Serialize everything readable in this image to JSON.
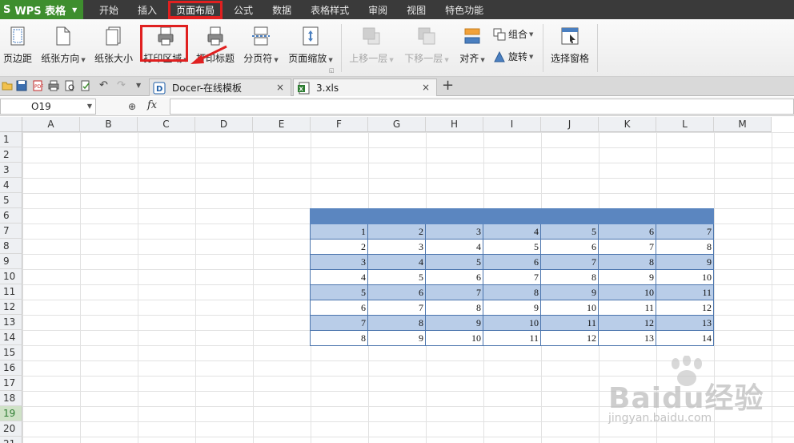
{
  "app": {
    "title": "WPS 表格"
  },
  "menu": [
    "开始",
    "插入",
    "页面布局",
    "公式",
    "数据",
    "表格样式",
    "审阅",
    "视图",
    "特色功能"
  ],
  "ribbon": {
    "margins": "页边距",
    "orientation": "纸张方向",
    "size": "纸张大小",
    "print_area": "打印区域",
    "print_titles": "打印标题",
    "breaks": "分页符",
    "scale": "页面缩放",
    "bring_forward": "上移一层",
    "send_backward": "下移一层",
    "align": "对齐",
    "group": "组合",
    "rotate": "旋转",
    "selection_pane": "选择窗格"
  },
  "tabs": {
    "tab1": "Docer-在线模板",
    "tab2": "3.xls",
    "close": "×",
    "add": "+"
  },
  "formula_bar": {
    "name_box": "O19",
    "fx": "fx"
  },
  "columns": [
    "A",
    "B",
    "C",
    "D",
    "E",
    "F",
    "G",
    "H",
    "I",
    "J",
    "K",
    "L",
    "M"
  ],
  "rows": [
    "1",
    "2",
    "3",
    "4",
    "5",
    "6",
    "7",
    "8",
    "9",
    "10",
    "11",
    "12",
    "13",
    "14",
    "15",
    "16",
    "17",
    "18",
    "19",
    "20",
    "21"
  ],
  "table": [
    [
      "1",
      "2",
      "3",
      "4",
      "5",
      "6",
      "7"
    ],
    [
      "2",
      "3",
      "4",
      "5",
      "6",
      "7",
      "8"
    ],
    [
      "3",
      "4",
      "5",
      "6",
      "7",
      "8",
      "9"
    ],
    [
      "4",
      "5",
      "6",
      "7",
      "8",
      "9",
      "10"
    ],
    [
      "5",
      "6",
      "7",
      "8",
      "9",
      "10",
      "11"
    ],
    [
      "6",
      "7",
      "8",
      "9",
      "10",
      "11",
      "12"
    ],
    [
      "7",
      "8",
      "9",
      "10",
      "11",
      "12",
      "13"
    ],
    [
      "8",
      "9",
      "10",
      "11",
      "12",
      "13",
      "14"
    ]
  ],
  "watermark": {
    "logo": "Baidu经验",
    "url": "jingyan.baidu.com"
  },
  "colors": {
    "menubar": "#3a3a3a",
    "app_green": "#3e8e2e",
    "highlight_red": "#e02020",
    "band_blue": "#b9cde8",
    "header_blue": "#5b86c0"
  }
}
